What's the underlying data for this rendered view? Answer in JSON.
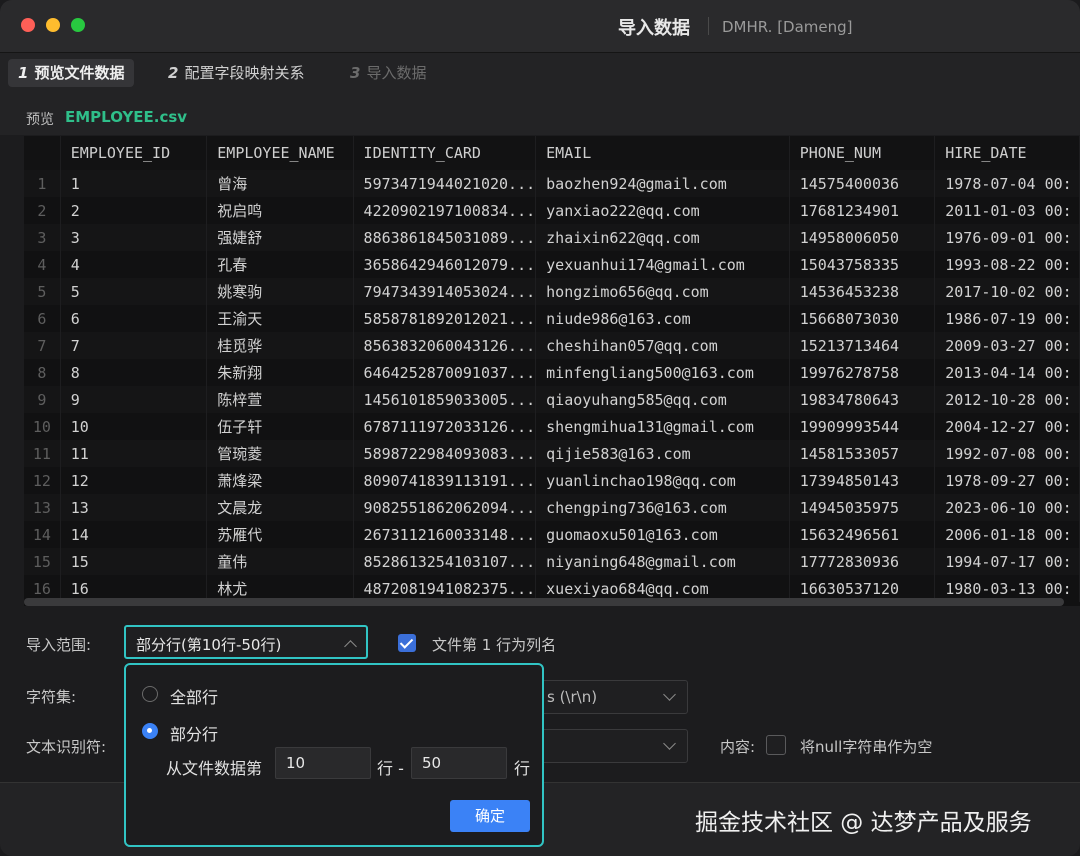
{
  "window": {
    "title": "导入数据",
    "subtitle": "DMHR. [Dameng]"
  },
  "steps": [
    {
      "num": "1",
      "label": "预览文件数据"
    },
    {
      "num": "2",
      "label": "配置字段映射关系"
    },
    {
      "num": "3",
      "label": "导入数据"
    }
  ],
  "preview": {
    "label": "预览",
    "filename": "EMPLOYEE.csv"
  },
  "table": {
    "columns": [
      "EMPLOYEE_ID",
      "EMPLOYEE_NAME",
      "IDENTITY_CARD",
      "EMAIL",
      "PHONE_NUM",
      "HIRE_DATE"
    ],
    "rows": [
      [
        "1",
        "1",
        "曾海",
        "5973471944021020...",
        "baozhen924@gmail.com",
        "14575400036",
        "1978-07-04 00:"
      ],
      [
        "2",
        "2",
        "祝启鸣",
        "4220902197100834...",
        "yanxiao222@qq.com",
        "17681234901",
        "2011-01-03 00:"
      ],
      [
        "3",
        "3",
        "强婕舒",
        "8863861845031089...",
        "zhaixin622@qq.com",
        "14958006050",
        "1976-09-01 00:"
      ],
      [
        "4",
        "4",
        "孔春",
        "3658642946012079...",
        "yexuanhui174@gmail.com",
        "15043758335",
        "1993-08-22 00:"
      ],
      [
        "5",
        "5",
        "姚寒驹",
        "7947343914053024...",
        "hongzimo656@qq.com",
        "14536453238",
        "2017-10-02 00:"
      ],
      [
        "6",
        "6",
        "王渝天",
        "5858781892012021...",
        "niude986@163.com",
        "15668073030",
        "1986-07-19 00:"
      ],
      [
        "7",
        "7",
        "桂觅骅",
        "8563832060043126...",
        "cheshihan057@qq.com",
        "15213713464",
        "2009-03-27 00:"
      ],
      [
        "8",
        "8",
        "朱新翔",
        "6464252870091037...",
        "minfengliang500@163.com",
        "19976278758",
        "2013-04-14 00:"
      ],
      [
        "9",
        "9",
        "陈梓萱",
        "1456101859033005...",
        "qiaoyuhang585@qq.com",
        "19834780643",
        "2012-10-28 00:"
      ],
      [
        "10",
        "10",
        "伍子轩",
        "6787111972033126...",
        "shengmihua131@gmail.com",
        "19909993544",
        "2004-12-27 00:"
      ],
      [
        "11",
        "11",
        "管琬菱",
        "5898722984093083...",
        "qijie583@163.com",
        "14581533057",
        "1992-07-08 00:"
      ],
      [
        "12",
        "12",
        "萧烽梁",
        "8090741839113191...",
        "yuanlinchao198@qq.com",
        "17394850143",
        "1978-09-27 00:"
      ],
      [
        "13",
        "13",
        "文晨龙",
        "9082551862062094...",
        "chengping736@163.com",
        "14945035975",
        "2023-06-10 00:"
      ],
      [
        "14",
        "14",
        "苏雁代",
        "2673112160033148...",
        "guomaoxu501@163.com",
        "15632496561",
        "2006-01-18 00:"
      ],
      [
        "15",
        "15",
        "童伟",
        "8528613254103107...",
        "niyaning648@gmail.com",
        "17772830936",
        "1994-07-17 00:"
      ],
      [
        "16",
        "16",
        "林尤",
        "4872081941082375...",
        "xuexiyao684@qq.com",
        "16630537120",
        "1980-03-13 00:"
      ]
    ]
  },
  "form": {
    "range_label": "导入范围:",
    "range_value": "部分行(第10行-50行)",
    "header_checkbox_label": "文件第 1 行为列名",
    "charset_label": "字符集:",
    "line_sep_value": "s (\\r\\n)",
    "text_qualifier_label": "文本识别符:",
    "content_label": "内容:",
    "null_checkbox_label": "将null字符串作为空"
  },
  "popup": {
    "option_all": "全部行",
    "option_partial": "部分行",
    "from_label": "从文件数据第",
    "start_value": "10",
    "row_dash": "行 -",
    "end_value": "50",
    "row_suffix": "行",
    "ok_label": "确定"
  },
  "watermark": "掘金技术社区 @ 达梦产品及服务"
}
